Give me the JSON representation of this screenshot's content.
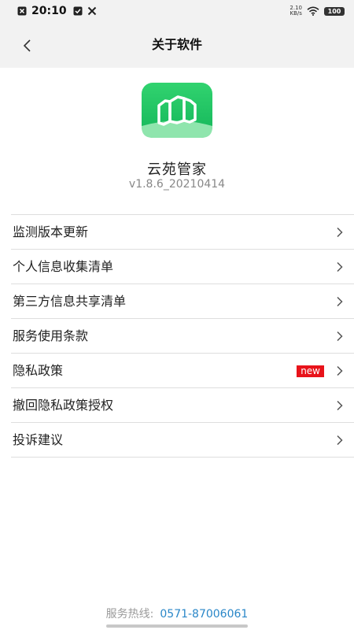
{
  "status_bar": {
    "time": "20:10",
    "net_speed_value": "2.10",
    "net_speed_unit": "KB/s",
    "battery": "100",
    "left_icons": [
      "notification-icon",
      "check-icon",
      "tools-icon"
    ],
    "right_icons": [
      "wifi-icon",
      "battery-icon"
    ]
  },
  "header": {
    "title": "关于软件",
    "back_icon": "chevron-left-icon"
  },
  "app": {
    "icon": "app-logo-icon",
    "name": "云苑管家",
    "version": "v1.8.6_20210414",
    "brand_color": "#2ecb6b"
  },
  "menu": {
    "items": [
      {
        "label": "监测版本更新"
      },
      {
        "label": "个人信息收集清单"
      },
      {
        "label": "第三方信息共享清单"
      },
      {
        "label": "服务使用条款"
      },
      {
        "label": "隐私政策",
        "badge": "new"
      },
      {
        "label": "撤回隐私政策授权"
      },
      {
        "label": "投诉建议"
      }
    ],
    "chevron_icon": "chevron-right-icon",
    "badge_color": "#e8131a"
  },
  "footer": {
    "hotline_label": "服务热线:",
    "hotline_number": "0571-87006061",
    "link_color": "#2a87c8"
  }
}
